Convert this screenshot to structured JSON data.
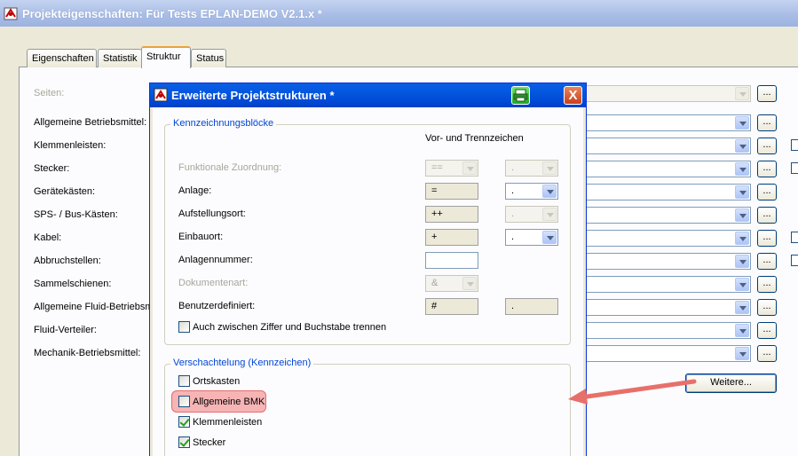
{
  "main_window": {
    "title": "Projekteigenschaften: Für Tests EPLAN-DEMO V2.1.x *"
  },
  "tabs": [
    "Eigenschaften",
    "Statistik",
    "Struktur",
    "Status"
  ],
  "active_tab": "Struktur",
  "fields": [
    {
      "label": "Seiten:",
      "disabled": true
    },
    {
      "label": "Allgemeine Betriebsmittel:",
      "disabled": false
    },
    {
      "label": "Klemmenleisten:",
      "disabled": false
    },
    {
      "label": "Stecker:",
      "disabled": false
    },
    {
      "label": "Gerätekästen:",
      "disabled": false
    },
    {
      "label": "SPS- / Bus-Kästen:",
      "disabled": false
    },
    {
      "label": "Kabel:",
      "disabled": false
    },
    {
      "label": "Abbruchstellen:",
      "disabled": false
    },
    {
      "label": "Sammelschienen:",
      "disabled": false
    },
    {
      "label": "Allgemeine Fluid-Betriebsmi",
      "disabled": false
    },
    {
      "label": "Fluid-Verteiler:",
      "disabled": false
    },
    {
      "label": "Mechanik-Betriebsmittel:",
      "disabled": false
    }
  ],
  "dots_label": "...",
  "weitere_label": "Weitere...",
  "dialog": {
    "title": "Erweiterte Projektstrukturen *",
    "close_label": "X",
    "group1_title": "Kennzeichnungsblöcke",
    "column_header": "Vor- und Trennzeichen",
    "rows": [
      {
        "label": "Funktionale Zuordnung:",
        "prefix": "==",
        "separator": ".",
        "disabled": true
      },
      {
        "label": "Anlage:",
        "prefix": "=",
        "separator": ".",
        "disabled": false
      },
      {
        "label": "Aufstellungsort:",
        "prefix": "++",
        "separator": ".",
        "disabled": false
      },
      {
        "label": "Einbauort:",
        "prefix": "+",
        "separator": ".",
        "disabled": false
      },
      {
        "label": "Anlagennummer:",
        "prefix": "",
        "separator": "",
        "disabled": false
      },
      {
        "label": "Dokumentenart:",
        "prefix": "&",
        "separator": "",
        "disabled": true
      },
      {
        "label": "Benutzerdefiniert:",
        "prefix": "#",
        "separator": ".",
        "disabled": false
      }
    ],
    "split_checkbox_label": "Auch zwischen Ziffer und Buchstabe trennen",
    "group2_title": "Verschachtelung (Kennzeichen)",
    "nesting": [
      {
        "label": "Ortskasten",
        "checked": false
      },
      {
        "label": "Allgemeine BMK",
        "checked": false
      },
      {
        "label": "Klemmenleisten",
        "checked": true
      },
      {
        "label": "Stecker",
        "checked": true
      }
    ]
  },
  "colors": {
    "highlight": "#f07878",
    "arrow": "#e8706a",
    "dialog_titlebar": "#0456de",
    "group_title": "#0046d5"
  }
}
